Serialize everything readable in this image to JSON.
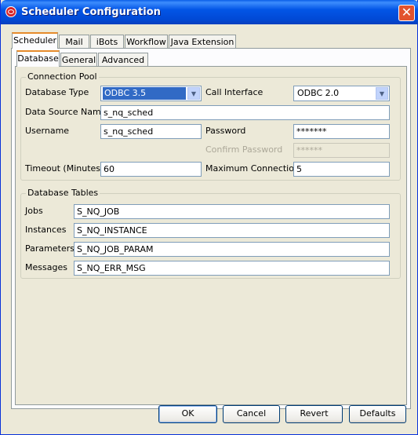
{
  "window": {
    "title": "Scheduler Configuration",
    "close_symbol": "✕"
  },
  "top_tabs": [
    {
      "label": "Scheduler"
    },
    {
      "label": "Mail"
    },
    {
      "label": "iBots"
    },
    {
      "label": "Workflow"
    },
    {
      "label": "Java Extension"
    }
  ],
  "sub_tabs": [
    {
      "label": "Database"
    },
    {
      "label": "General"
    },
    {
      "label": "Advanced"
    }
  ],
  "connection_pool": {
    "legend": "Connection Pool",
    "database_type": {
      "label": "Database Type",
      "value": "ODBC 3.5"
    },
    "call_interface": {
      "label": "Call Interface",
      "value": "ODBC 2.0"
    },
    "data_source_name": {
      "label": "Data Source Name",
      "value": "s_nq_sched"
    },
    "username": {
      "label": "Username",
      "value": "s_nq_sched"
    },
    "password": {
      "label": "Password",
      "value": "*******"
    },
    "confirm_password": {
      "label": "Confirm Password",
      "value": "******"
    },
    "timeout": {
      "label": "Timeout (Minutes)",
      "value": "60"
    },
    "max_connections": {
      "label": "Maximum Connections",
      "value": "5"
    }
  },
  "database_tables": {
    "legend": "Database Tables",
    "jobs": {
      "label": "Jobs",
      "value": "S_NQ_JOB"
    },
    "instances": {
      "label": "Instances",
      "value": "S_NQ_INSTANCE"
    },
    "parameters": {
      "label": "Parameters",
      "value": "S_NQ_JOB_PARAM"
    },
    "messages": {
      "label": "Messages",
      "value": "S_NQ_ERR_MSG"
    }
  },
  "buttons": {
    "ok": "OK",
    "cancel": "Cancel",
    "revert": "Revert",
    "defaults": "Defaults"
  }
}
